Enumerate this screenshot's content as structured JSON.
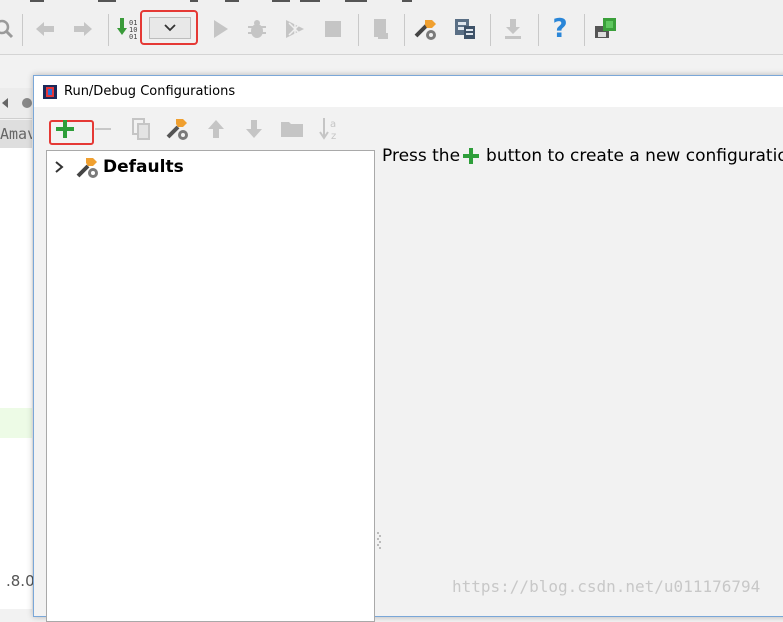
{
  "toolbar": {
    "items": [
      {
        "icon": "search-icon"
      },
      {
        "icon": "back-arrow-icon"
      },
      {
        "icon": "forward-arrow-icon"
      },
      {
        "icon": "build-icon"
      },
      {
        "icon": "run-configuration-dropdown-icon"
      },
      {
        "icon": "run-icon"
      },
      {
        "icon": "debug-icon"
      },
      {
        "icon": "coverage-icon"
      },
      {
        "icon": "stop-icon"
      },
      {
        "icon": "vcs-icon"
      },
      {
        "icon": "project-structure-icon"
      },
      {
        "icon": "sdk-manager-icon"
      },
      {
        "icon": "download-icon"
      },
      {
        "icon": "help-icon"
      },
      {
        "icon": "device-manager-icon"
      }
    ],
    "help_glyph": "?"
  },
  "background": {
    "side_fragment": "Amav",
    "version_fragment": ".8.0"
  },
  "dialog": {
    "title": "Run/Debug Configurations",
    "toolbar_items": [
      {
        "icon": "add-icon",
        "enabled": true,
        "color": "#2e9e3a"
      },
      {
        "icon": "remove-icon",
        "enabled": false
      },
      {
        "icon": "copy-icon",
        "enabled": false
      },
      {
        "icon": "edit-defaults-icon",
        "enabled": true
      },
      {
        "icon": "move-up-icon",
        "enabled": false
      },
      {
        "icon": "move-down-icon",
        "enabled": false
      },
      {
        "icon": "folder-icon",
        "enabled": false
      },
      {
        "icon": "sort-icon",
        "enabled": false,
        "glyph": "a z"
      }
    ],
    "tree": {
      "items": [
        {
          "label": "Defaults",
          "icon": "defaults-icon",
          "expanded": false
        }
      ]
    },
    "hint": {
      "before": "Press the",
      "after": "button to create a new configuratio"
    }
  },
  "watermark": "https://blog.csdn.net/u011176794",
  "colors": {
    "highlight_border": "#e53935",
    "add_green": "#2e9e3a",
    "dialog_border": "#7aa7d8"
  }
}
